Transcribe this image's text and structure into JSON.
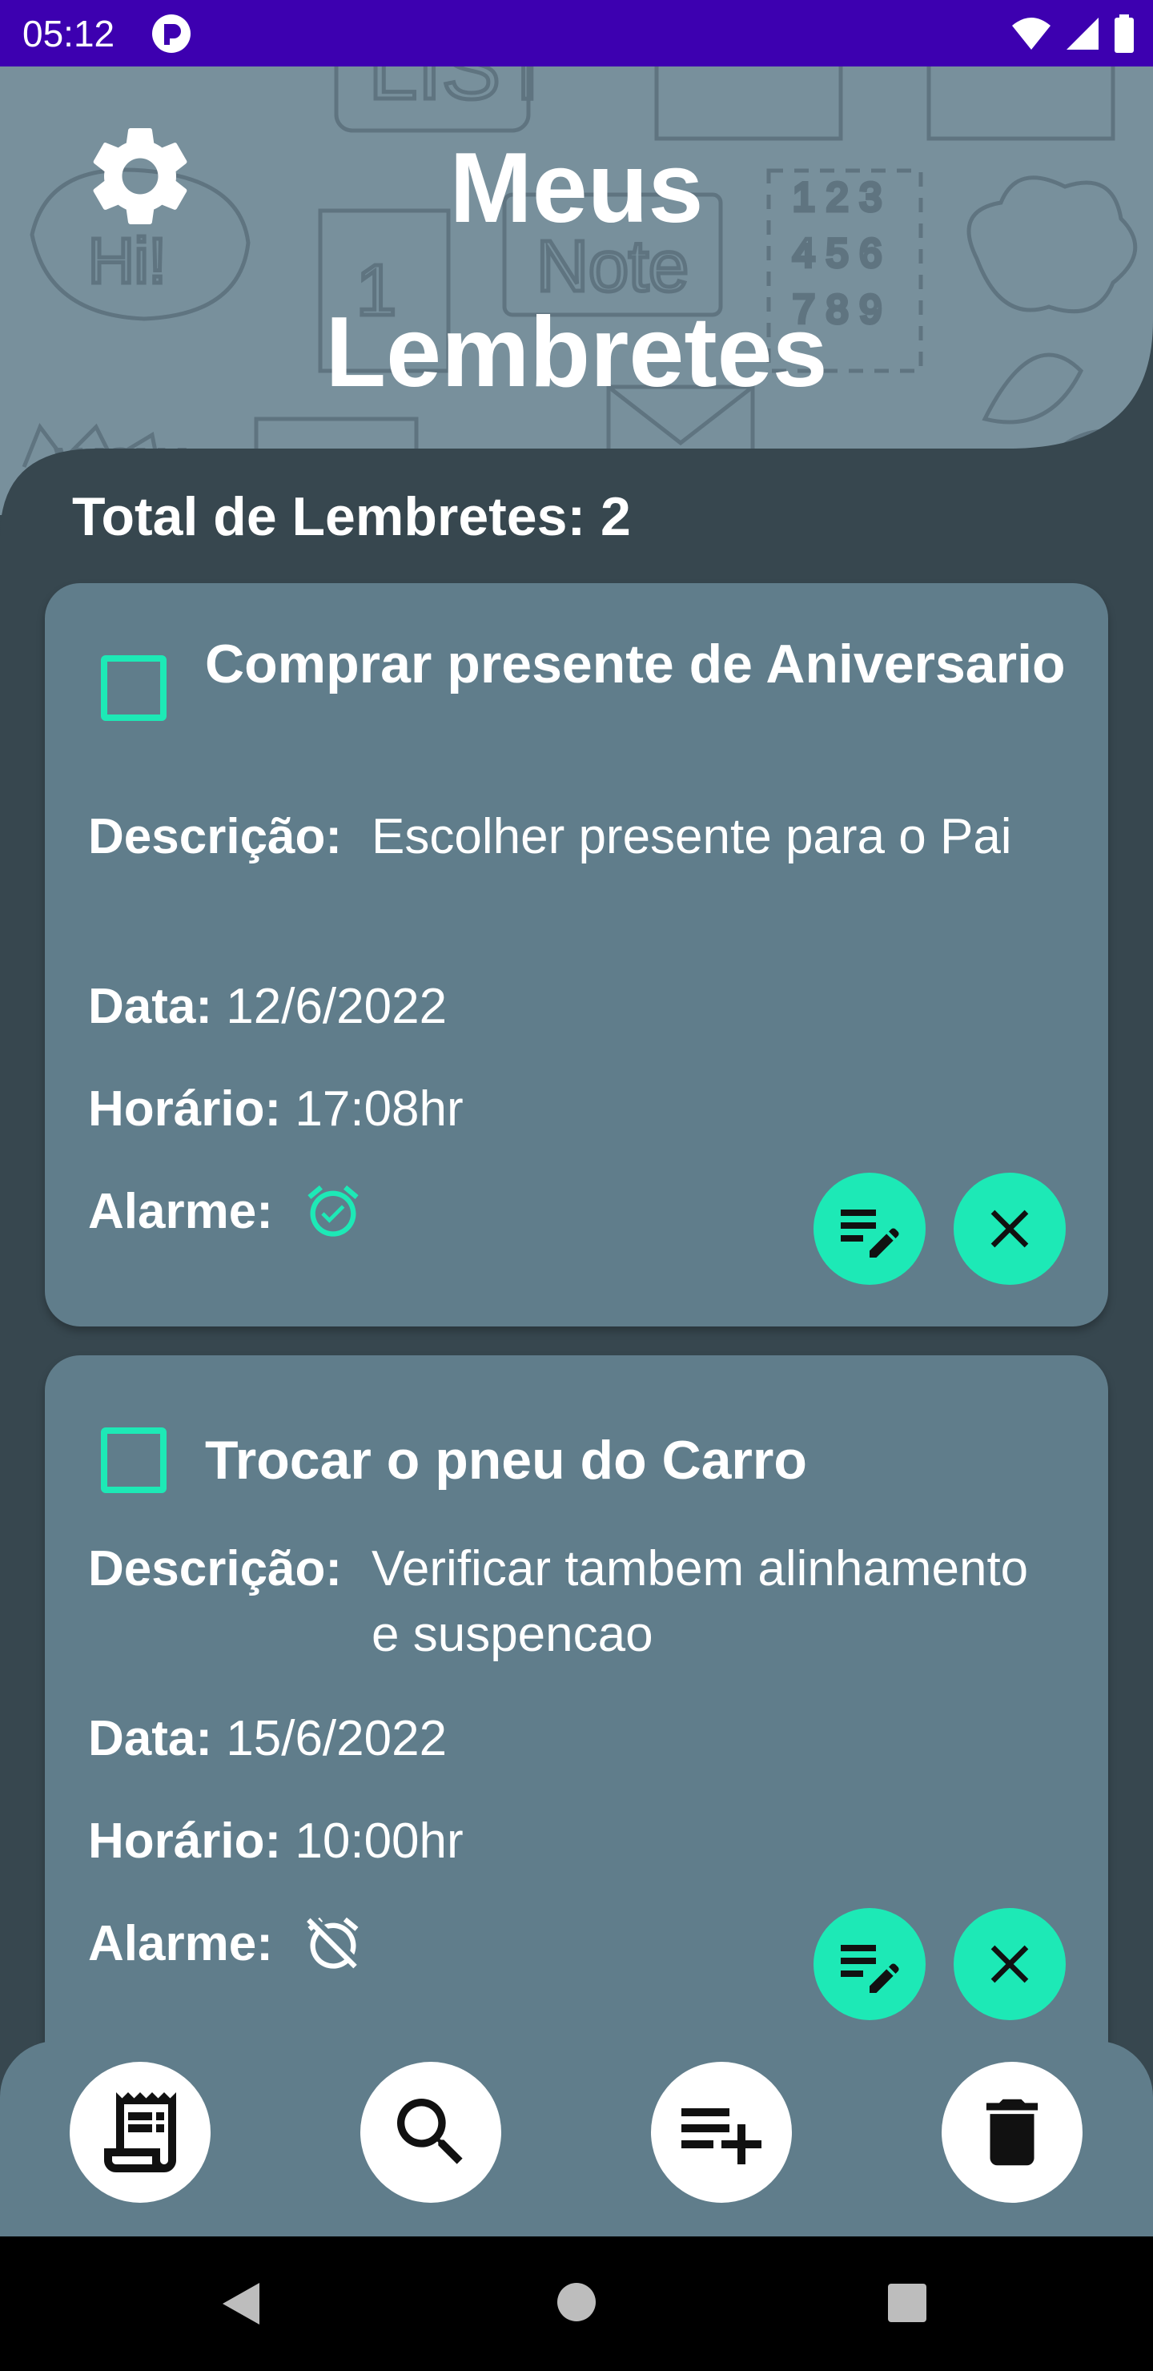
{
  "status_bar": {
    "time": "05:12"
  },
  "header": {
    "title_line1": "Meus",
    "title_line2": "Lembretes"
  },
  "summary": {
    "total_label": "Total de Lembretes: 2"
  },
  "labels": {
    "description": "Descrição:",
    "date": "Data:",
    "time": "Horário:",
    "alarm": "Alarme:"
  },
  "reminders": [
    {
      "title": "Comprar presente de Aniversario",
      "description": "Escolher presente para o Pai",
      "date": "12/6/2022",
      "time": "17:08hr",
      "checked": false,
      "alarm": "alarm-on-icon"
    },
    {
      "title": "Trocar o pneu do Carro",
      "description": "Verificar tambem alinhamento e suspencao",
      "date": "15/6/2022",
      "time": "10:00hr",
      "checked": false,
      "alarm": "alarm-off-icon"
    }
  ],
  "bottom_nav": [
    "receipt-icon",
    "search-icon",
    "add-list-icon",
    "delete-icon"
  ],
  "colors": {
    "status_bar": "#3d00b0",
    "header": "#78909c",
    "background": "#37474f",
    "card": "#607d8b",
    "accent": "#1de9b6",
    "nav_button": "#ffffff"
  }
}
